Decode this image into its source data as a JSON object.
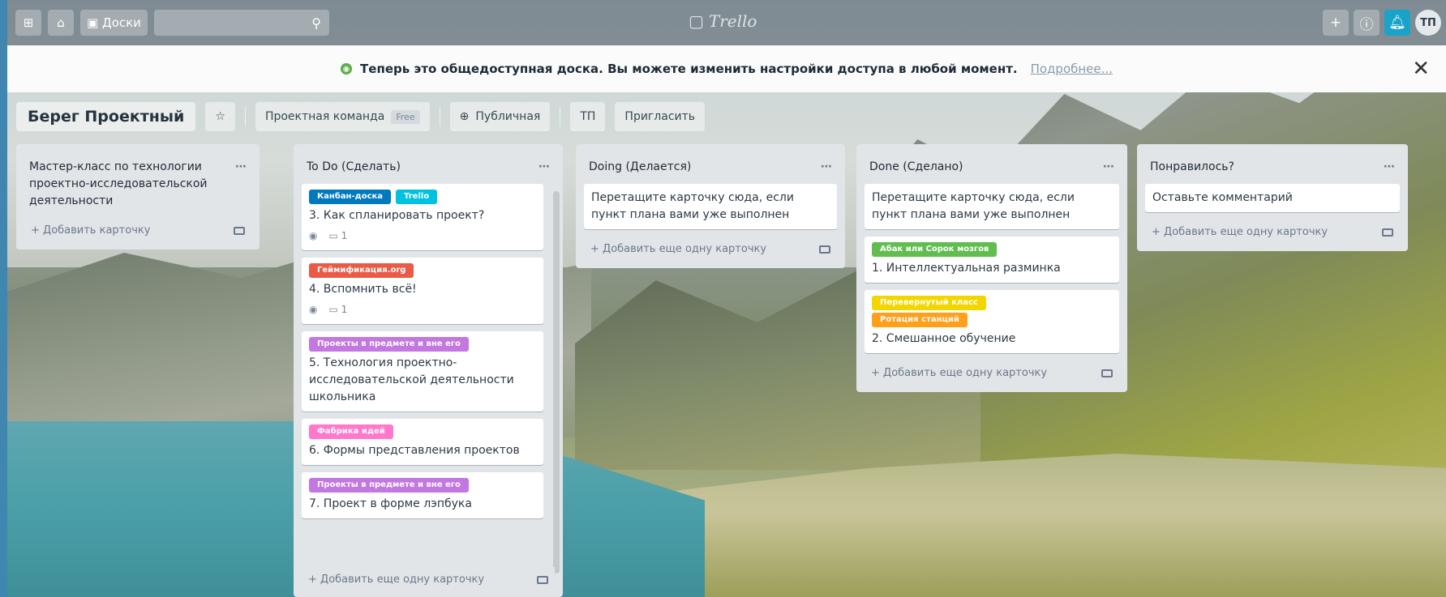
{
  "header": {
    "board_btn": "Доски",
    "logo": "Trello",
    "avatar": "ТП"
  },
  "banner": {
    "text": "Теперь это общедоступная доска. Вы можете изменить настройки доступа в любой момент.",
    "link": "Подробнее..."
  },
  "board": {
    "title": "Берег Проектный",
    "team": "Проектная команда",
    "team_tag": "Free",
    "visibility": "Публичная",
    "member": "ТП",
    "invite": "Пригласить"
  },
  "lists": [
    {
      "title": "Мастер-класс по технологии проектно-исследовательской деятельности",
      "add": "Добавить карточку",
      "cards": []
    },
    {
      "title": "To Do (Сделать)",
      "add": "Добавить еще одну карточку",
      "cards": [
        {
          "labels": [
            {
              "text": "Канбан-доска",
              "color": "#0079bf"
            },
            {
              "text": "Trello",
              "color": "#00c2e0"
            }
          ],
          "title": "3. Как спланировать проект?",
          "badges": {
            "watch": "◉",
            "comments": "1"
          }
        },
        {
          "labels": [
            {
              "text": "Геймификация.org",
              "color": "#eb5a46"
            }
          ],
          "title": "4. Вспомнить всё!",
          "badges": {
            "watch": "◉",
            "comments": "1"
          }
        },
        {
          "labels": [
            {
              "text": "Проекты в предмете и вне его",
              "color": "#c377e0"
            }
          ],
          "title": "5. Технология проектно-исследовательской деятельности школьника",
          "badges": null
        },
        {
          "labels": [
            {
              "text": "Фабрика идей",
              "color": "#ff78cb"
            }
          ],
          "title": "6. Формы представления проектов",
          "badges": null
        },
        {
          "labels": [
            {
              "text": "Проекты в предмете и вне его",
              "color": "#c377e0"
            }
          ],
          "title": "7. Проект в форме лэпбука",
          "badges": null
        }
      ]
    },
    {
      "title": "Doing (Делается)",
      "add": "Добавить еще одну карточку",
      "cards": [
        {
          "labels": [],
          "title": "Перетащите карточку сюда, если пункт плана вами уже выполнен",
          "badges": null
        }
      ]
    },
    {
      "title": "Done (Сделано)",
      "add": "Добавить еще одну карточку",
      "cards": [
        {
          "labels": [],
          "title": "Перетащите карточку сюда, если пункт плана вами уже выполнен",
          "badges": null
        },
        {
          "labels": [
            {
              "text": "Абак или Сорок мозгов",
              "color": "#61bd4f"
            }
          ],
          "title": "1. Интеллектуальная разминка",
          "badges": null
        },
        {
          "labels": [
            {
              "text": "Перевернутый класс",
              "color": "#f2d600"
            },
            {
              "text": "Ротация станций",
              "color": "#ff9f1a"
            }
          ],
          "title": "2. Смешанное обучение",
          "badges": null
        }
      ]
    },
    {
      "title": "Понравилось?",
      "add": "Добавить еще одну карточку",
      "cards": [
        {
          "labels": [],
          "title": "Оставьте комментарий",
          "badges": null
        }
      ]
    }
  ]
}
